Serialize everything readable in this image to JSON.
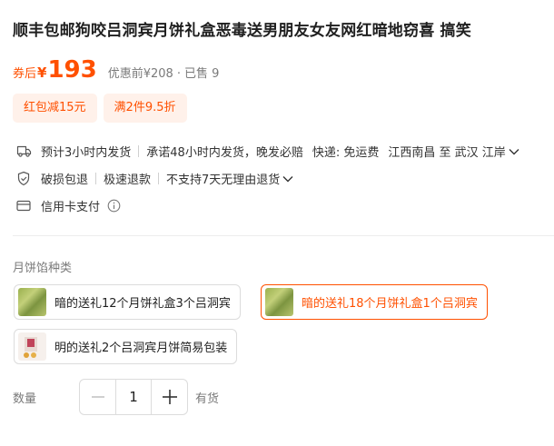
{
  "product": {
    "title": "顺丰包邮狗咬吕洞宾月饼礼盒恶毒送男朋友女友网红暗地窃喜 搞笑"
  },
  "price": {
    "prefix": "券后",
    "currency": "¥",
    "value": "193",
    "original": "优惠前¥208",
    "separator": "·",
    "sold": "已售 9"
  },
  "coupons": [
    "红包减15元",
    "满2件9.5折"
  ],
  "delivery": {
    "estimate": "预计3小时内发货",
    "promise": "承诺48小时内发货，晚发必赔",
    "express": "快递: 免运费",
    "route": "江西南昌 至 武汉 江岸"
  },
  "service": {
    "items": [
      "破损包退",
      "极速退款",
      "不支持7天无理由退货"
    ]
  },
  "payment": {
    "label": "信用卡支付"
  },
  "sku": {
    "section_label": "月饼馅种类",
    "options": [
      {
        "label": "暗的送礼12个月饼礼盒3个吕洞宾",
        "selected": false,
        "thumb": "cake-thumbnail"
      },
      {
        "label": "暗的送礼18个月饼礼盒1个吕洞宾",
        "selected": true,
        "thumb": "cake-thumbnail"
      },
      {
        "label": "明的送礼2个吕洞宾月饼简易包装",
        "selected": false,
        "thumb": "box-thumbnail"
      }
    ]
  },
  "quantity": {
    "label": "数量",
    "value": "1",
    "stock": "有货"
  },
  "colors": {
    "accent": "#ff5000",
    "coupon_bg": "#fff1ea",
    "muted_text": "#7a7a7a"
  }
}
